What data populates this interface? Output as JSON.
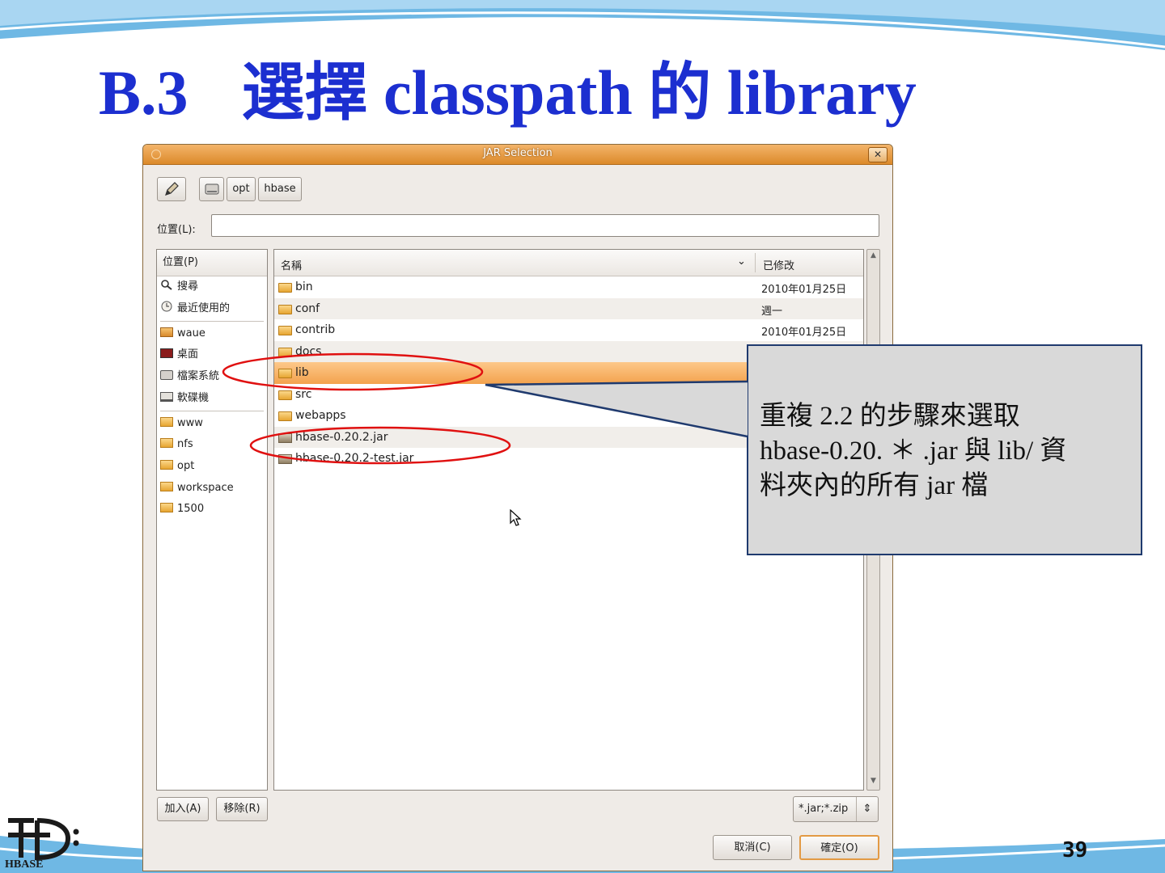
{
  "slide": {
    "title_num": "B.3",
    "title_text": "選擇 classpath  的 library",
    "page_number": "39",
    "logo_text": "HBASE"
  },
  "dialog": {
    "title": "JAR Selection",
    "close_glyph": "✕",
    "path_buttons": [
      "opt",
      "hbase"
    ],
    "location_label": "位置(L):",
    "location_value": "",
    "places_header": "位置(P)",
    "places": [
      {
        "label": "搜尋",
        "icon": "search-icon"
      },
      {
        "label": "最近使用的",
        "icon": "recent-icon"
      },
      {
        "label": "waue",
        "icon": "home-folder-icon"
      },
      {
        "label": "桌面",
        "icon": "desktop-icon"
      },
      {
        "label": "檔案系統",
        "icon": "drive-icon"
      },
      {
        "label": "軟碟機",
        "icon": "floppy-icon"
      },
      {
        "label": "www",
        "icon": "folder-icon"
      },
      {
        "label": "nfs",
        "icon": "folder-icon"
      },
      {
        "label": "opt",
        "icon": "folder-icon"
      },
      {
        "label": "workspace",
        "icon": "folder-icon"
      },
      {
        "label": "1500",
        "icon": "folder-icon"
      }
    ],
    "columns": {
      "name": "名稱",
      "modified": "已修改"
    },
    "files": [
      {
        "name": "bin",
        "modified": "2010年01月25日",
        "type": "folder"
      },
      {
        "name": "conf",
        "modified": "週一",
        "type": "folder"
      },
      {
        "name": "contrib",
        "modified": "2010年01月25日",
        "type": "folder"
      },
      {
        "name": "docs",
        "modified": "",
        "type": "folder"
      },
      {
        "name": "lib",
        "modified": "",
        "type": "folder",
        "selected": true
      },
      {
        "name": "src",
        "modified": "",
        "type": "folder"
      },
      {
        "name": "webapps",
        "modified": "",
        "type": "folder"
      },
      {
        "name": "hbase-0.20.2.jar",
        "modified": "",
        "type": "jar"
      },
      {
        "name": "hbase-0.20.2-test.jar",
        "modified": "",
        "type": "jar"
      }
    ],
    "add_button": "加入(A)",
    "remove_button": "移除(R)",
    "filter_value": "*.jar;*.zip",
    "cancel_button": "取消(C)",
    "ok_button": "確定(O)"
  },
  "callout": {
    "line1": "重複 2.2  的步驟來選取",
    "line2": "hbase-0.20. ＊ .jar  與   lib/ 資",
    "line3": "料夾內的所有    jar  檔"
  },
  "colors": {
    "title_blue": "#1c2fd0",
    "titlebar_orange": "#dc8a2a",
    "selection_orange": "#f3a24d",
    "annotation_red": "#e01010",
    "callout_border": "#1f3a6e"
  }
}
